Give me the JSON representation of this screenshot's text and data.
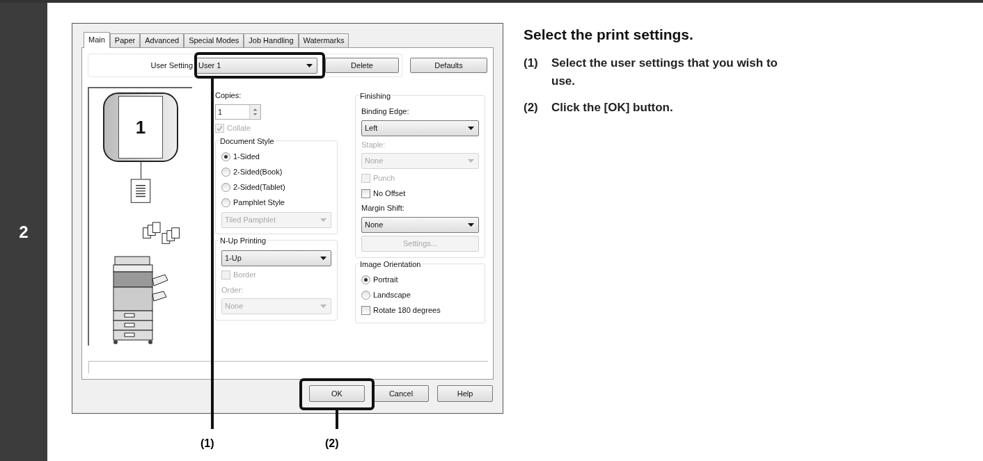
{
  "step_number": "2",
  "dialog": {
    "tabs": [
      {
        "label": "Main",
        "selected": true
      },
      {
        "label": "Paper",
        "selected": false
      },
      {
        "label": "Advanced",
        "selected": false
      },
      {
        "label": "Special Modes",
        "selected": false
      },
      {
        "label": "Job Handling",
        "selected": false
      },
      {
        "label": "Watermarks",
        "selected": false
      }
    ],
    "user_setting": {
      "label": "User Setting",
      "value": "User 1"
    },
    "top_buttons": [
      "Delete",
      "Defaults"
    ],
    "preview": {
      "page_number": "1"
    },
    "columns": [
      {
        "blocks": [
          {
            "kind": "plain",
            "controls": [
              {
                "kind": "label",
                "text": "Copies:",
                "disabled": false
              },
              {
                "kind": "spinner",
                "value": "1"
              },
              {
                "kind": "checkbox",
                "label": "Collate",
                "checked": true,
                "disabled": true
              }
            ]
          },
          {
            "kind": "group",
            "title": "Document Style",
            "controls": [
              {
                "kind": "radio",
                "label": "1-Sided",
                "selected": true,
                "disabled": false
              },
              {
                "kind": "radio",
                "label": "2-Sided(Book)",
                "selected": false,
                "disabled": false
              },
              {
                "kind": "radio",
                "label": "2-Sided(Tablet)",
                "selected": false,
                "disabled": false
              },
              {
                "kind": "radio",
                "label": "Pamphlet Style",
                "selected": false,
                "disabled": false
              },
              {
                "kind": "select",
                "value": "Tiled Pamphlet",
                "disabled": true
              }
            ]
          },
          {
            "kind": "group",
            "title": "N-Up Printing",
            "controls": [
              {
                "kind": "select",
                "value": "1-Up",
                "disabled": false
              },
              {
                "kind": "checkbox",
                "label": "Border",
                "checked": false,
                "disabled": true
              },
              {
                "kind": "label",
                "text": "Order:",
                "disabled": true
              },
              {
                "kind": "select",
                "value": "None",
                "disabled": true
              }
            ]
          }
        ]
      },
      {
        "blocks": [
          {
            "kind": "group",
            "title": "Finishing",
            "controls": [
              {
                "kind": "label",
                "text": "Binding Edge:",
                "disabled": false
              },
              {
                "kind": "select",
                "value": "Left",
                "disabled": false
              },
              {
                "kind": "label",
                "text": "Staple:",
                "disabled": true
              },
              {
                "kind": "select",
                "value": "None",
                "disabled": true
              },
              {
                "kind": "checkbox",
                "label": "Punch",
                "checked": false,
                "disabled": true
              },
              {
                "kind": "checkbox",
                "label": "No Offset",
                "checked": false,
                "disabled": false
              },
              {
                "kind": "label",
                "text": "Margin Shift:",
                "disabled": false
              },
              {
                "kind": "select",
                "value": "None",
                "disabled": false
              },
              {
                "kind": "button",
                "label": "Settings...",
                "disabled": true
              }
            ]
          },
          {
            "kind": "group",
            "title": "Image Orientation",
            "controls": [
              {
                "kind": "radio",
                "label": "Portrait",
                "selected": true,
                "disabled": false
              },
              {
                "kind": "radio",
                "label": "Landscape",
                "selected": false,
                "disabled": false
              },
              {
                "kind": "checkbox",
                "label": "Rotate 180 degrees",
                "checked": false,
                "disabled": false
              }
            ]
          }
        ]
      }
    ],
    "bottom_buttons": [
      "OK",
      "Cancel",
      "Help"
    ]
  },
  "callouts": [
    {
      "label": "(1)"
    },
    {
      "label": "(2)"
    }
  ],
  "instructions": {
    "heading": "Select the print settings.",
    "steps": [
      {
        "number": "(1)",
        "text": "Select the user settings that you wish to use."
      },
      {
        "number": "(2)",
        "text": "Click the [OK] button."
      }
    ]
  }
}
